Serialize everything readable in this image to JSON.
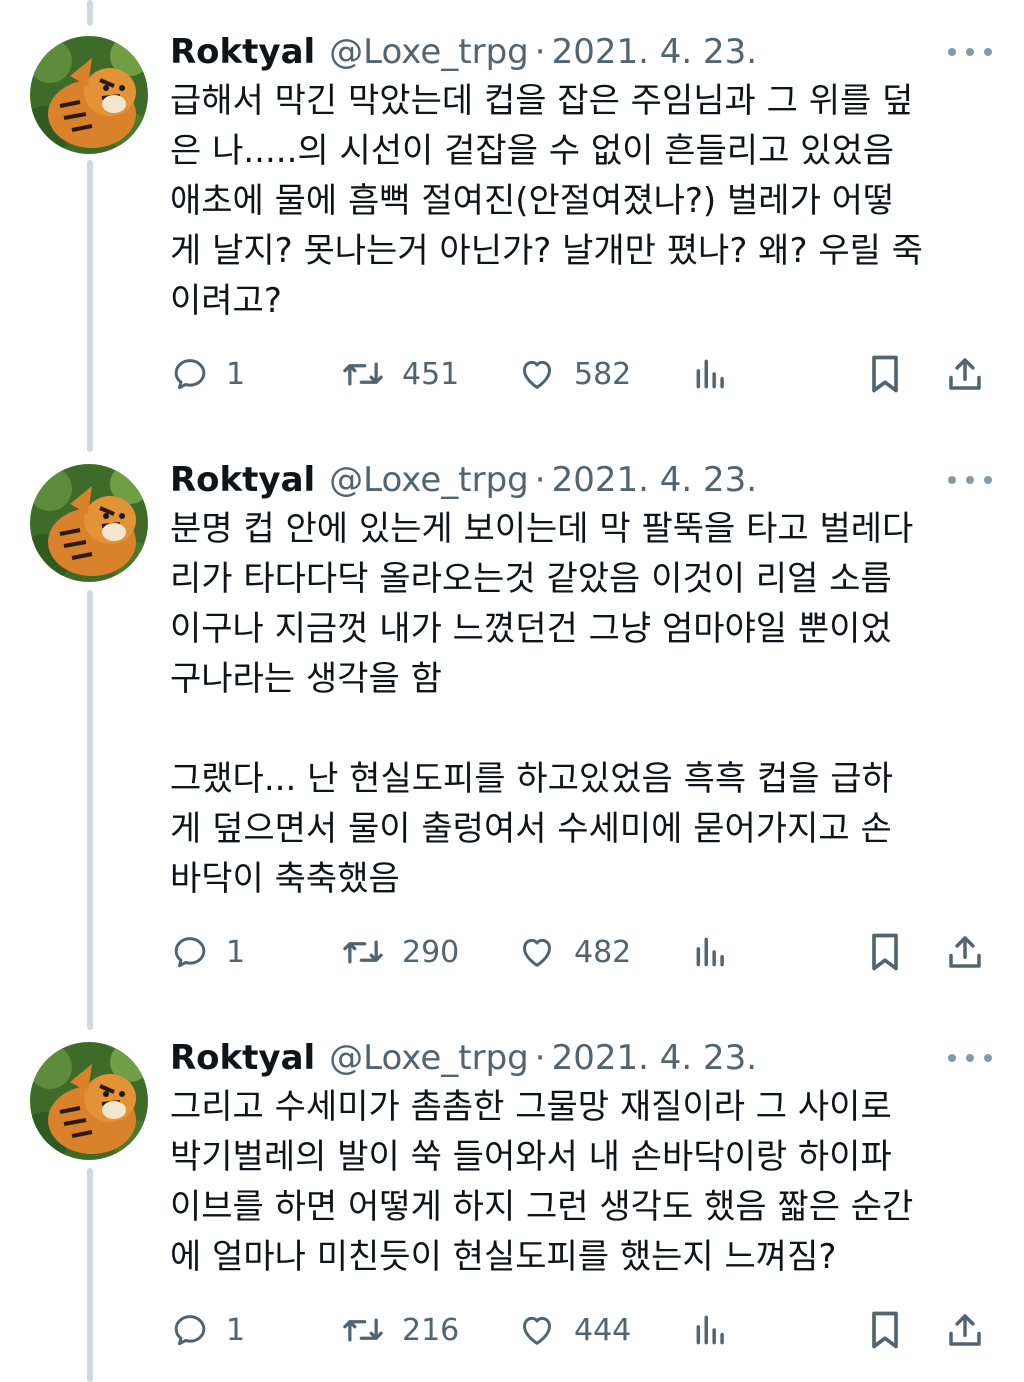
{
  "thread": {
    "tweets": [
      {
        "author_name": "Roktyal",
        "handle": "@Loxe_trpg",
        "separator": "·",
        "date": "2021. 4. 23.",
        "text": "급해서 막긴 막았는데 컵을 잡은 주임님과 그 위를 덮\n은 나.....의 시선이 겉잡을 수 없이 흔들리고 있었음\n애초에 물에 흠뻑 절여진(안절여졌나?) 벌레가 어떻\n게 날지? 못나는거 아닌가? 날개만 폈나? 왜? 우릴 죽\n이려고?",
        "replies": "1",
        "retweets": "451",
        "likes": "582"
      },
      {
        "author_name": "Roktyal",
        "handle": "@Loxe_trpg",
        "separator": "·",
        "date": "2021. 4. 23.",
        "text": "분명 컵 안에 있는게 보이는데 막 팔뚝을 타고 벌레다\n리가 타다다닥 올라오는것 같았음 이것이 리얼 소름\n이구나 지금껏 내가 느꼈던건 그냥 엄마야일 뿐이었\n구나라는 생각을 함\n\n그랬다... 난 현실도피를 하고있었음 흑흑 컵을 급하\n게 덮으면서 물이 출렁여서 수세미에 묻어가지고 손\n바닥이 축축했음",
        "replies": "1",
        "retweets": "290",
        "likes": "482"
      },
      {
        "author_name": "Roktyal",
        "handle": "@Loxe_trpg",
        "separator": "·",
        "date": "2021. 4. 23.",
        "text": "그리고 수세미가 촘촘한 그물망 재질이라 그 사이로\n박기벌레의 발이 쑥 들어와서 내 손바닥이랑 하이파\n이브를 하면 어떻게 하지 그런 생각도 했음 짧은 순간\n에 얼마나 미친듯이 현실도피를 했는지 느껴짐?",
        "replies": "1",
        "retweets": "216",
        "likes": "444"
      }
    ]
  },
  "icons": {
    "reply": "reply-icon",
    "retweet": "retweet-icon",
    "like": "heart-icon",
    "views": "analytics-icon",
    "bookmark": "bookmark-icon",
    "share": "share-icon",
    "more": "more-icon",
    "avatar": "tiger-avatar"
  },
  "colors": {
    "text_primary": "#0f1419",
    "text_secondary": "#536471",
    "thread_line": "#cfd9de",
    "background": "#ffffff"
  }
}
